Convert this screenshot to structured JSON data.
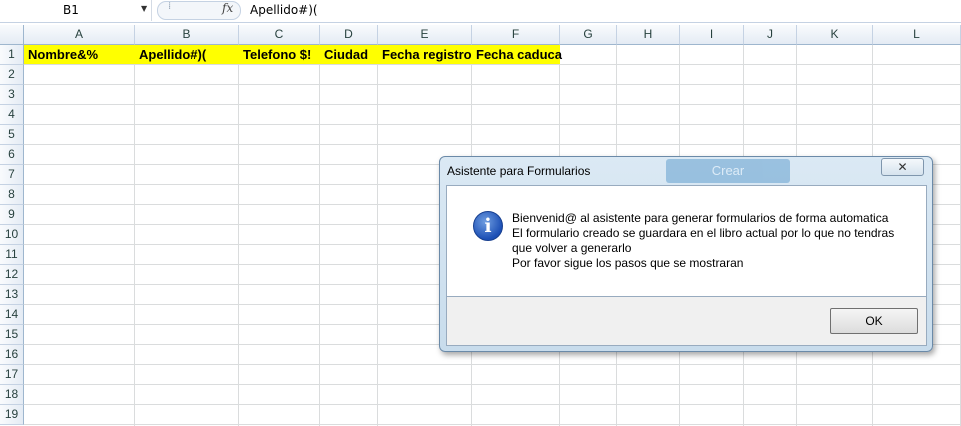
{
  "formula_bar": {
    "name_box": "B1",
    "fx_label": "fx",
    "content": "Apellido#)("
  },
  "columns": [
    "A",
    "B",
    "C",
    "D",
    "E",
    "F",
    "G",
    "H",
    "I",
    "J",
    "K",
    "L"
  ],
  "rows": [
    "1",
    "2",
    "3",
    "4",
    "5",
    "6",
    "7",
    "8",
    "9",
    "10",
    "11",
    "12",
    "13",
    "14",
    "15",
    "16",
    "17",
    "18",
    "19"
  ],
  "row1_cells": [
    "Nombre&%",
    "Apellido#)(",
    "Telefono $!",
    "Ciudad",
    "Fecha registro",
    "Fecha caduca"
  ],
  "colors": {
    "header_fill": "#ffff00",
    "dialog_frame": "#c8dcec",
    "info_icon": "#1c4fb5"
  },
  "dialog": {
    "title": "Asistente para Formularios",
    "background_button": "Crear",
    "close_label": "✕",
    "icon": "info-icon",
    "message_lines": [
      "Bienvenid@ al asistente para generar formularios de forma automatica",
      "El formulario creado se guardara en el libro actual por lo que no tendras",
      "que volver a generarlo",
      "Por favor sigue los pasos que se mostraran"
    ],
    "ok_label": "OK"
  }
}
